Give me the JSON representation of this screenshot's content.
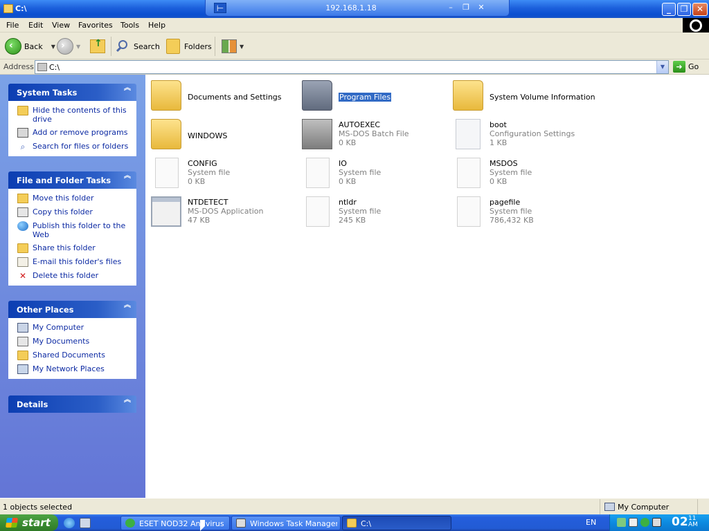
{
  "window": {
    "title": "C:\\",
    "remote_host": "192.168.1.18",
    "pin_glyph": "⊢",
    "rc_min_glyph": "–",
    "rc_restore_glyph": "❐",
    "rc_close_glyph": "✕",
    "min_glyph": "_",
    "max_glyph": "❐",
    "close_glyph": "✕"
  },
  "menu": [
    "File",
    "Edit",
    "View",
    "Favorites",
    "Tools",
    "Help"
  ],
  "toolbar": {
    "back_label": "Back",
    "search_label": "Search",
    "folders_label": "Folders"
  },
  "address": {
    "label": "Address",
    "value": "C:\\",
    "go_label": "Go"
  },
  "sidebar": {
    "system_tasks": {
      "title": "System Tasks",
      "items": [
        "Hide the contents of this drive",
        "Add or remove programs",
        "Search for files or folders"
      ]
    },
    "file_folder_tasks": {
      "title": "File and Folder Tasks",
      "items": [
        "Move this folder",
        "Copy this folder",
        "Publish this folder to the Web",
        "Share this folder",
        "E-mail this folder's files",
        "Delete this folder"
      ]
    },
    "other_places": {
      "title": "Other Places",
      "items": [
        "My Computer",
        "My Documents",
        "Shared Documents",
        "My Network Places"
      ]
    },
    "details": {
      "title": "Details"
    },
    "chevron": "︽"
  },
  "files": [
    {
      "name": "Documents and Settings",
      "type": "",
      "size": "",
      "icon": "folder-icon"
    },
    {
      "name": "Program Files",
      "type": "",
      "size": "",
      "icon": "folder-icon",
      "selected": true
    },
    {
      "name": "System Volume Information",
      "type": "",
      "size": "",
      "icon": "folder-icon"
    },
    {
      "name": "WINDOWS",
      "type": "",
      "size": "",
      "icon": "folder-icon"
    },
    {
      "name": "AUTOEXEC",
      "type": "MS-DOS Batch File",
      "size": "0 KB",
      "icon": "batch-file-icon"
    },
    {
      "name": "boot",
      "type": "Configuration Settings",
      "size": "1 KB",
      "icon": "config-file-icon"
    },
    {
      "name": "CONFIG",
      "type": "System file",
      "size": "0 KB",
      "icon": "file-icon"
    },
    {
      "name": "IO",
      "type": "System file",
      "size": "0 KB",
      "icon": "file-icon"
    },
    {
      "name": "MSDOS",
      "type": "System file",
      "size": "0 KB",
      "icon": "file-icon"
    },
    {
      "name": "NTDETECT",
      "type": "MS-DOS Application",
      "size": "47 KB",
      "icon": "application-icon"
    },
    {
      "name": "ntldr",
      "type": "System file",
      "size": "245 KB",
      "icon": "file-icon"
    },
    {
      "name": "pagefile",
      "type": "System file",
      "size": "786,432 KB",
      "icon": "file-icon"
    }
  ],
  "status": {
    "selection": "1 objects selected",
    "location": "My Computer"
  },
  "taskbar": {
    "start_label": "start",
    "tasks": [
      "ESET NOD32 Antivirus",
      "Windows Task Manager",
      "C:\\"
    ],
    "language": "EN",
    "clock_time": "02",
    "clock_minutes": "11",
    "clock_ampm": "AM"
  },
  "colors": {
    "selection": "#316ac5",
    "sidebar_link": "#0c2aa3",
    "titlebar": "#0b4fd0",
    "taskbar": "#245edc"
  }
}
